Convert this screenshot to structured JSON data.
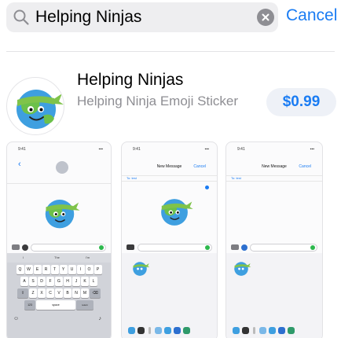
{
  "search": {
    "query": "Helping Ninjas",
    "cancel_label": "Cancel"
  },
  "app": {
    "title": "Helping Ninjas",
    "subtitle": "Helping Ninja Emoji Sticker",
    "price": "$0.99"
  },
  "screenshots": [
    {
      "status_time": "9:41",
      "keyboard_rows": [
        [
          "Q",
          "W",
          "E",
          "R",
          "T",
          "Y",
          "U",
          "I",
          "O",
          "P"
        ],
        [
          "A",
          "S",
          "D",
          "F",
          "G",
          "H",
          "J",
          "K",
          "L"
        ],
        [
          "Z",
          "X",
          "C",
          "V",
          "B",
          "N",
          "M"
        ]
      ],
      "suggestions": [
        "I",
        "The",
        "I'm"
      ],
      "return_label": "return",
      "numbers_label": "123",
      "space_label": "space"
    },
    {
      "status_time": "9:41",
      "nav_title": "New Message",
      "nav_cancel": "Cancel",
      "to_label": "To: test"
    },
    {
      "status_time": "9:41",
      "nav_title": "New Message",
      "nav_cancel": "Cancel",
      "to_label": "To: test"
    }
  ],
  "colors": {
    "accent": "#1a7cf3",
    "price_bg": "#eef1f7",
    "search_bg": "#eeeef0"
  },
  "icons": [
    "search-icon",
    "clear-icon",
    "ninja-globe-icon"
  ]
}
